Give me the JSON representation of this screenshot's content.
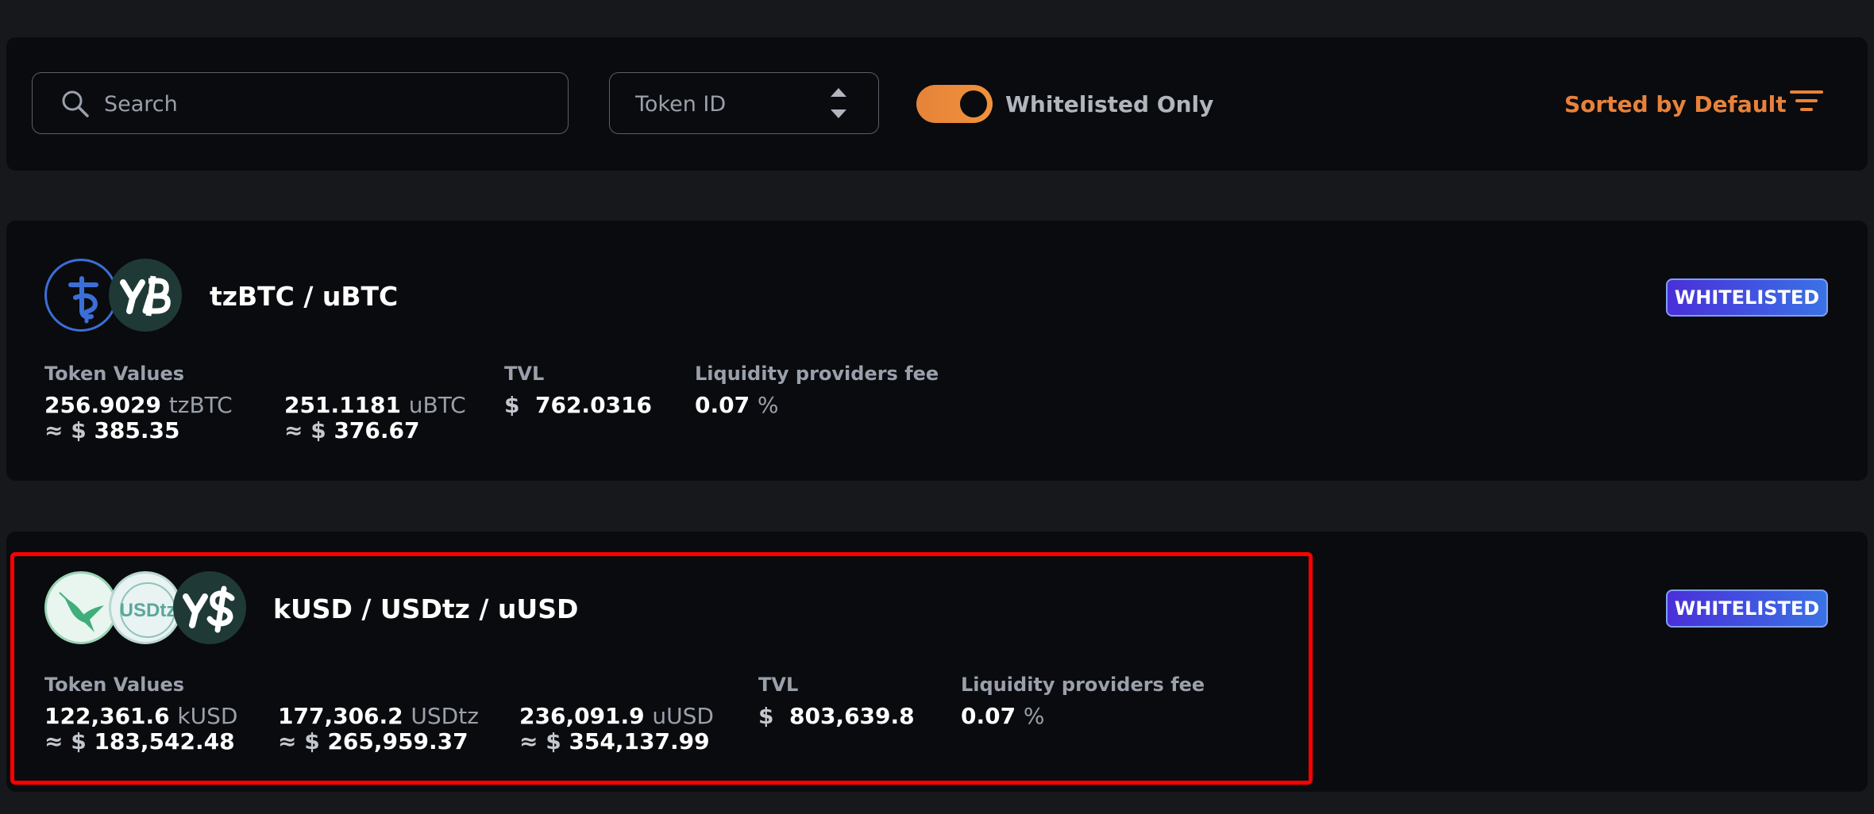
{
  "filters": {
    "search_placeholder": "Search",
    "token_id_placeholder": "Token ID",
    "whitelisted_toggle_label": "Whitelisted Only",
    "whitelisted_toggle_on": true,
    "sort_label": "Sorted by Default"
  },
  "colors": {
    "accent": "#e8823a",
    "badge_gradient": [
      "#4a2fd8",
      "#3a72e6"
    ],
    "highlight_border": "#ff0000"
  },
  "pools": [
    {
      "name": "tzBTC / uBTC",
      "badge": "WHITELISTED",
      "token_logos": [
        "tzbtc-icon",
        "ubtc-icon"
      ],
      "token_values_label": "Token Values",
      "tokens": [
        {
          "amount": "256.9029",
          "symbol": "tzBTC",
          "approx_prefix": "≈ $",
          "usd": "385.35"
        },
        {
          "amount": "251.1181",
          "symbol": "uBTC",
          "approx_prefix": "≈ $",
          "usd": "376.67"
        }
      ],
      "tvl_label": "TVL",
      "tvl_currency": "$",
      "tvl_value": "762.0316",
      "fee_label": "Liquidity providers fee",
      "fee_value": "0.07",
      "fee_unit": "%"
    },
    {
      "name": "kUSD / USDtz / uUSD",
      "badge": "WHITELISTED",
      "token_logos": [
        "kusd-hummingbird-icon",
        "usdtz-icon",
        "uusd-icon"
      ],
      "token_values_label": "Token Values",
      "tokens": [
        {
          "amount": "122,361.6",
          "symbol": "kUSD",
          "approx_prefix": "≈ $",
          "usd": "183,542.48"
        },
        {
          "amount": "177,306.2",
          "symbol": "USDtz",
          "approx_prefix": "≈ $",
          "usd": "265,959.37"
        },
        {
          "amount": "236,091.9",
          "symbol": "uUSD",
          "approx_prefix": "≈ $",
          "usd": "354,137.99"
        }
      ],
      "tvl_label": "TVL",
      "tvl_currency": "$",
      "tvl_value": "803,639.8",
      "fee_label": "Liquidity providers fee",
      "fee_value": "0.07",
      "fee_unit": "%",
      "highlighted": true
    }
  ]
}
